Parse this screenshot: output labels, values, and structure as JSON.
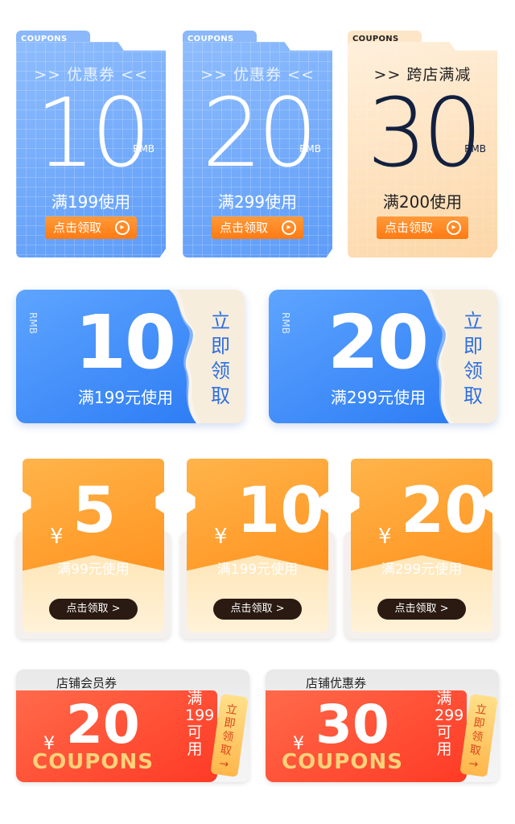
{
  "row1": [
    {
      "tab": "COUPONS",
      "head": ">> 优惠券 <<",
      "value": "10",
      "unit": "RMB",
      "condition": "满199使用",
      "button": "点击领取",
      "arrow": "▸"
    },
    {
      "tab": "COUPONS",
      "head": ">> 优惠券 <<",
      "value": "20",
      "unit": "RMB",
      "condition": "满299使用",
      "button": "点击领取",
      "arrow": "▸"
    },
    {
      "tab": "COUPONS",
      "head": ">> 跨店满减",
      "value": "30",
      "unit": "RMB",
      "condition": "满200使用",
      "button": "点击领取",
      "arrow": "▸"
    }
  ],
  "row2": [
    {
      "unit": "RMB",
      "value": "10",
      "condition": "满199元使用",
      "action": "立即领取"
    },
    {
      "unit": "RMB",
      "value": "20",
      "condition": "满299元使用",
      "action": "立即领取"
    }
  ],
  "row3": [
    {
      "symbol": "¥",
      "value": "5",
      "condition": "满99元使用",
      "button": "点击领取 >"
    },
    {
      "symbol": "¥",
      "value": "10",
      "condition": "满199元使用",
      "button": "点击领取 >"
    },
    {
      "symbol": "¥",
      "value": "20",
      "condition": "满299元使用",
      "button": "点击领取 >"
    }
  ],
  "row4": [
    {
      "title": "店铺会员券",
      "symbol": "¥",
      "value": "20",
      "word": "COUPONS",
      "condition": "满199可用",
      "tag": "立即领取",
      "tag_arrow": "→"
    },
    {
      "title": "店铺优惠券",
      "symbol": "¥",
      "value": "30",
      "word": "COUPONS",
      "condition": "满299可用",
      "tag": "立即领取",
      "tag_arrow": "→"
    }
  ],
  "colors": {
    "blue": "#4f95fb",
    "orange": "#ff8f1a",
    "peach": "#fde1bd",
    "red": "#ff3a25",
    "navy": "#13203f"
  }
}
